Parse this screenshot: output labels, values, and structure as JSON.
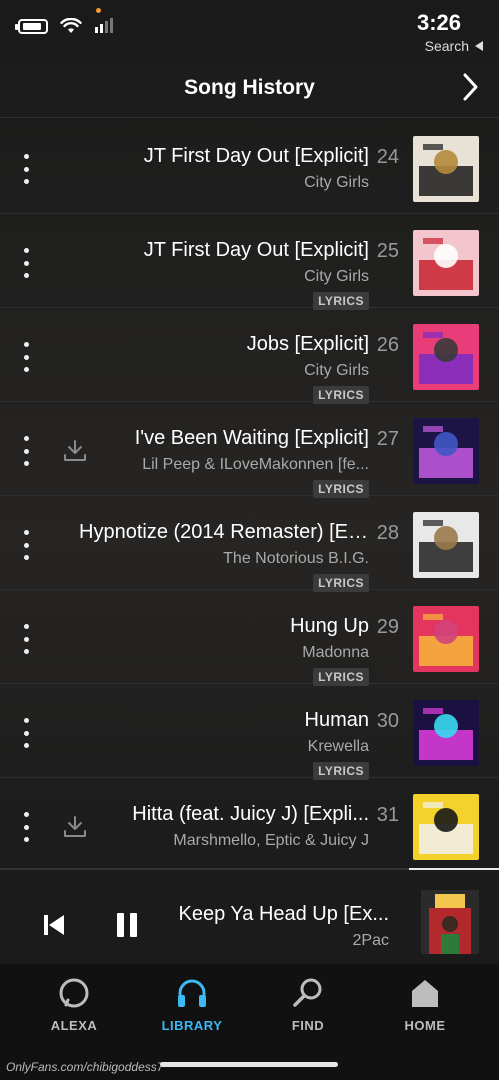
{
  "status": {
    "time": "3:26",
    "back_label": "Search"
  },
  "header": {
    "title": "Song History"
  },
  "songs": [
    {
      "num": "24",
      "title": "JT First Day Out [Explicit]",
      "artist": "City Girls",
      "badge": "",
      "download": false,
      "art_colors": [
        "#e8e2d6",
        "#1b1b1b",
        "#b58b3c"
      ]
    },
    {
      "num": "25",
      "title": "JT First Day Out [Explicit]",
      "artist": "City Girls",
      "badge": "LYRICS",
      "download": false,
      "art_colors": [
        "#f3c5cc",
        "#c7222f",
        "#ffffff"
      ]
    },
    {
      "num": "26",
      "title": "Jobs [Explicit]",
      "artist": "City Girls",
      "badge": "LYRICS",
      "download": false,
      "art_colors": [
        "#e93d7a",
        "#7a2bc6",
        "#3a3a3a"
      ]
    },
    {
      "num": "27",
      "title": "I've Been Waiting [Explicit]",
      "artist": "Lil Peep & ILoveMakonnen [fe...",
      "badge": "LYRICS",
      "download": true,
      "art_colors": [
        "#1c1444",
        "#c45ae2",
        "#4056c8"
      ]
    },
    {
      "num": "28",
      "title": "Hypnotize (2014 Remaster) [Ex...",
      "artist": "The Notorious B.I.G.",
      "badge": "LYRICS",
      "download": false,
      "art_colors": [
        "#e8e8e8",
        "#202020",
        "#9a7a4a"
      ]
    },
    {
      "num": "29",
      "title": "Hung Up",
      "artist": "Madonna",
      "badge": "LYRICS",
      "download": false,
      "art_colors": [
        "#e4355f",
        "#f7b63a",
        "#d1437a"
      ]
    },
    {
      "num": "30",
      "title": "Human",
      "artist": "Krewella",
      "badge": "LYRICS",
      "download": false,
      "art_colors": [
        "#1a1140",
        "#e33de0",
        "#39d9f0"
      ]
    },
    {
      "num": "31",
      "title": "Hitta (feat. Juicy J) [Expli...",
      "artist": "Marshmello, Eptic & Juicy J",
      "badge": "",
      "download": true,
      "art_colors": [
        "#f4d22c",
        "#f1f1f1",
        "#181818"
      ]
    }
  ],
  "now_playing": {
    "title": "Keep Ya Head Up [Ex...",
    "artist": "2Pac"
  },
  "tabs": [
    {
      "label": "HOME",
      "icon": "home-icon"
    },
    {
      "label": "FIND",
      "icon": "search-icon"
    },
    {
      "label": "LIBRARY",
      "icon": "headphones-icon"
    },
    {
      "label": "ALEXA",
      "icon": "alexa-icon"
    }
  ],
  "watermark": "OnlyFans.com/chibigoddess7",
  "colors": {
    "accent": "#3cb8f4",
    "background": "#1e1e1e"
  }
}
